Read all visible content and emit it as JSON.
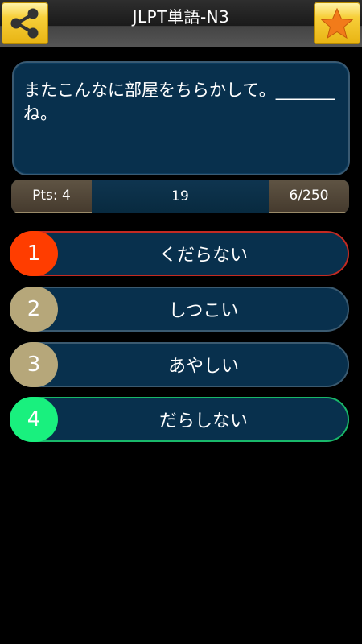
{
  "header": {
    "title": "JLPT単語-N3",
    "share_icon": "share-icon",
    "favorite_icon": "star-icon",
    "accent": "#f7cf3a"
  },
  "question": {
    "text": "またこんなに部屋をちらかして。_______ね。"
  },
  "status": {
    "points": "Pts: 4",
    "timer": "19",
    "progress": "6/250"
  },
  "answers": [
    {
      "number": "1",
      "text": "くだらない",
      "state": "incorrect",
      "color": "#ff3d00"
    },
    {
      "number": "2",
      "text": "しつこい",
      "state": "neutral",
      "color": "#b6a77a"
    },
    {
      "number": "3",
      "text": "あやしい",
      "state": "neutral",
      "color": "#b6a77a"
    },
    {
      "number": "4",
      "text": "だらしない",
      "state": "correct",
      "color": "#19f07e"
    }
  ]
}
